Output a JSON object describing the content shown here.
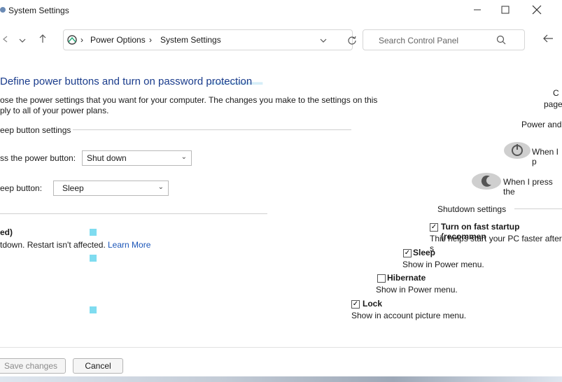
{
  "window": {
    "title": "System Settings",
    "minimize_icon": "minimize-icon",
    "maximize_icon": "maximize-icon",
    "close_icon": "close-icon"
  },
  "nav": {
    "back_icon": "back-arrow-icon",
    "dropdown_icon": "chevron-down-icon",
    "up_icon": "up-arrow-icon",
    "breadcrumb": [
      "Power Options",
      "System Settings"
    ],
    "separator": "›",
    "refresh_icon": "refresh-icon",
    "search_placeholder": "Search Control Panel",
    "search_icon": "search-icon",
    "right_back_icon": "back-arrow-icon"
  },
  "main": {
    "heading": "Define power buttons and turn on password protection",
    "description_line1": "ose the power settings that you want for your computer. The changes you make to the settings on this",
    "description_line2": "ply to all of your power plans.",
    "sleep_section_title": "eep button settings",
    "power_button_label": "ss the power button:",
    "power_button_value": "Shut down",
    "sleep_button_label": "eep button:",
    "sleep_button_value": "Sleep",
    "recommended_fragment": "ed)",
    "fast_startup_desc": "tdown. Restart isn't affected.",
    "learn_more": "Learn More"
  },
  "right": {
    "fragment_c": "C",
    "fragment_page": "page",
    "fragment_power_and": "Power and",
    "fragment_when_i_p": "When I p",
    "fragment_when_i_press": "When I press the",
    "shutdown_title": "Shutdown settings",
    "fast_startup_label": "Turn on fast startup (recommen",
    "fast_startup_help": "This helps start your PC faster after s",
    "sleep_label": "Sleep",
    "sleep_help": "Show in Power menu.",
    "hibernate_label": "Hibernate",
    "hibernate_help": "Show in Power menu.",
    "lock_label": "Lock",
    "lock_help": "Show in account picture menu."
  },
  "footer": {
    "save_label": "Save changes",
    "cancel_label": "Cancel"
  },
  "checks": {
    "fast_startup": true,
    "sleep": true,
    "hibernate": false,
    "lock": true
  },
  "colors": {
    "heading": "#1a3c8c",
    "link": "#1a55b8",
    "accent_ghost": "#7fdcf0"
  }
}
